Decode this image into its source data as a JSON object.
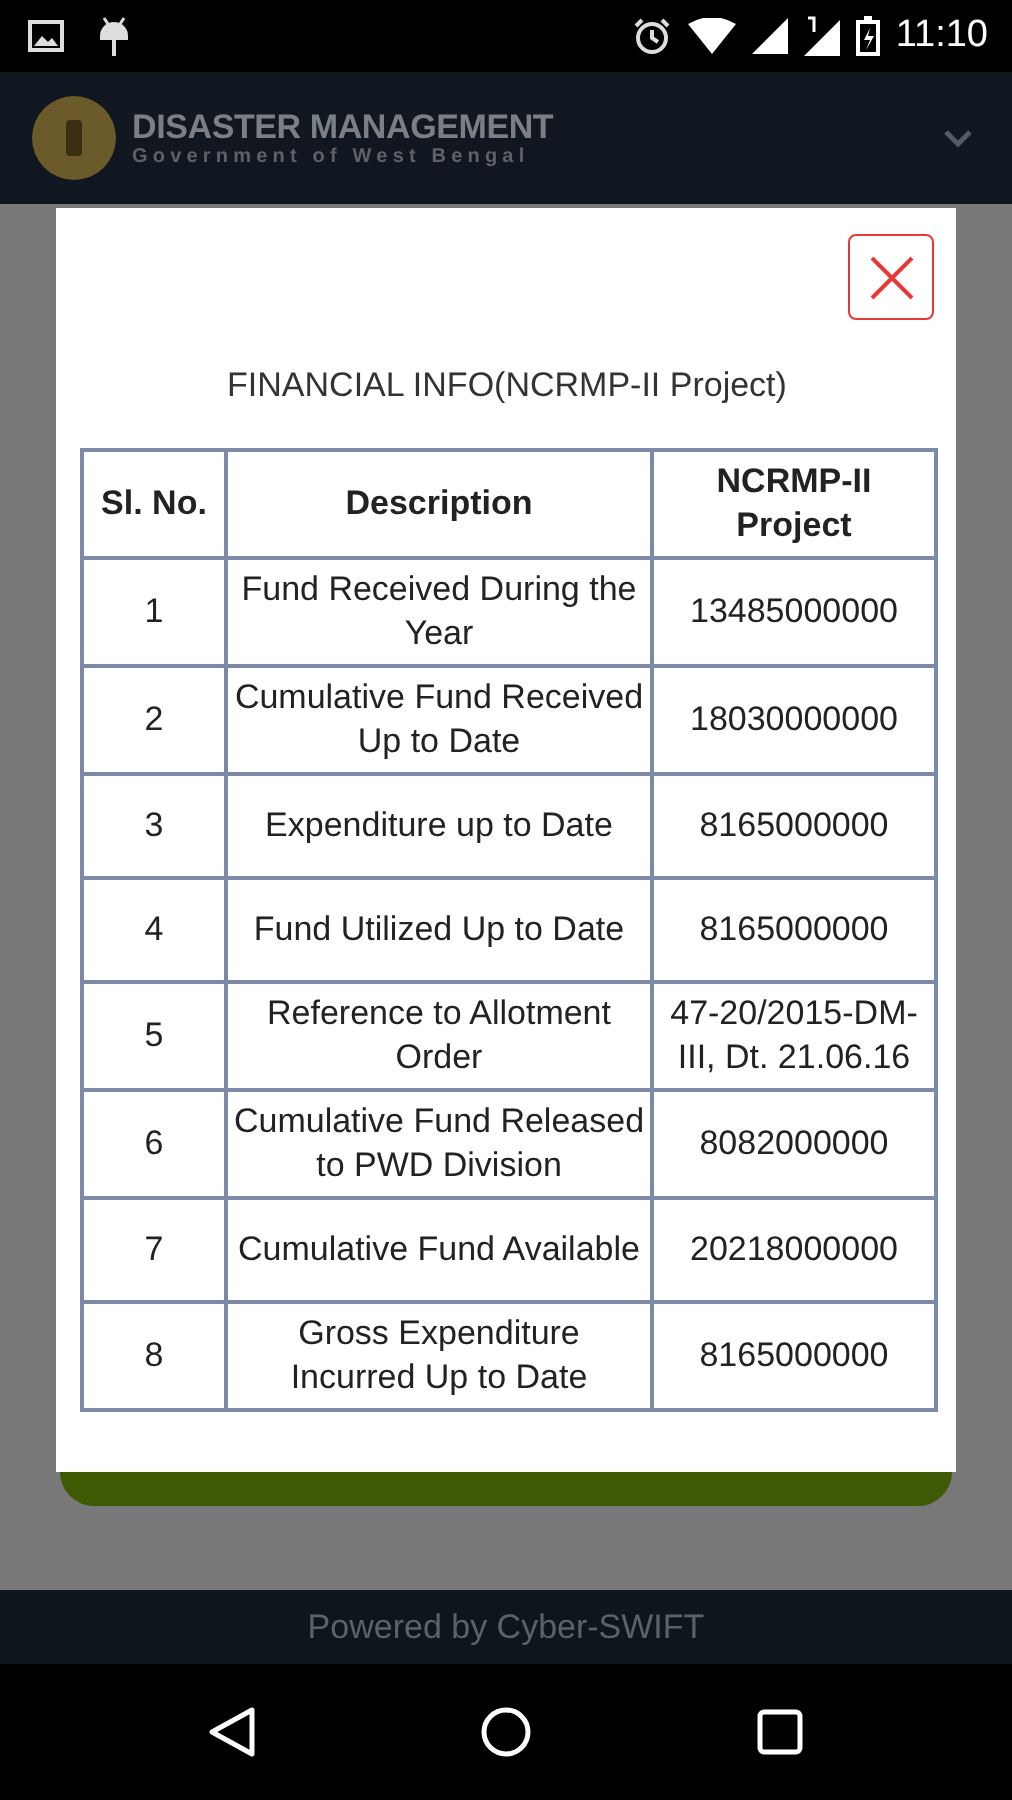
{
  "status_bar": {
    "time": "11:10"
  },
  "app_bar": {
    "title": "DISASTER MANAGEMENT",
    "subtitle": "Government of West Bengal"
  },
  "dialog": {
    "title": "FINANCIAL INFO(NCRMP-II Project)",
    "table": {
      "columns": [
        "Sl. No.",
        "Description",
        "NCRMP-II Project"
      ],
      "rows": [
        [
          "1",
          "Fund Received During the Year",
          "13485000000"
        ],
        [
          "2",
          "Cumulative Fund Received Up to Date",
          "18030000000"
        ],
        [
          "3",
          "Expenditure up to Date",
          "8165000000"
        ],
        [
          "4",
          "Fund Utilized Up to Date",
          "8165000000"
        ],
        [
          "5",
          "Reference to Allotment Order",
          "47-20/2015-DM-III, Dt. 21.06.16"
        ],
        [
          "6",
          "Cumulative Fund Released to PWD Division",
          "8082000000"
        ],
        [
          "7",
          "Cumulative Fund Available",
          "20218000000"
        ],
        [
          "8",
          "Gross Expenditure Incurred Up to Date",
          "8165000000"
        ]
      ]
    }
  },
  "footer": {
    "text": "Powered by Cyber-SWIFT"
  }
}
